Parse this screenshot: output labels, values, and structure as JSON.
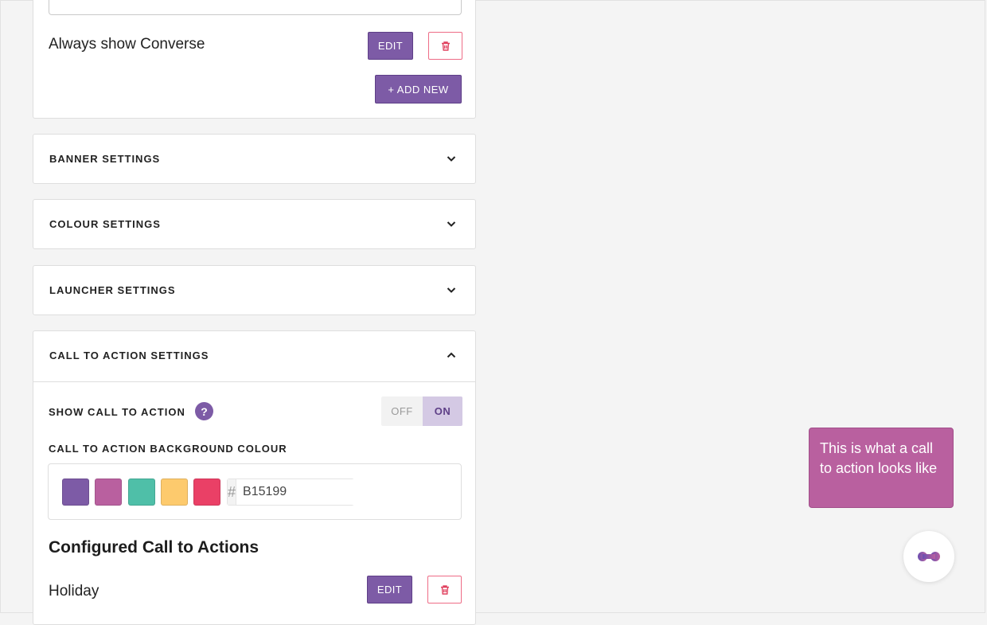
{
  "rules": {
    "items": [
      {
        "label": "Always show Converse",
        "edit_label": "EDIT"
      }
    ],
    "add_new_label": "+ ADD NEW"
  },
  "sections": {
    "banner": "BANNER SETTINGS",
    "colour": "COLOUR SETTINGS",
    "launcher": "LAUNCHER SETTINGS"
  },
  "cta": {
    "title": "CALL TO ACTION SETTINGS",
    "show_label": "SHOW CALL TO ACTION",
    "help_glyph": "?",
    "toggle": {
      "off": "OFF",
      "on": "ON",
      "state": "ON"
    },
    "bg_colour_label": "CALL TO ACTION BACKGROUND COLOUR",
    "swatches": [
      "#7d5ba6",
      "#b9609f",
      "#4fbfa8",
      "#fdca6d",
      "#ea4066"
    ],
    "hex_prefix": "#",
    "hex_value": "B15199",
    "configured_title": "Configured Call to Actions",
    "configured_items": [
      {
        "label": "Holiday",
        "edit_label": "EDIT"
      }
    ]
  },
  "preview": {
    "tooltip_text": "This is what a call to action looks like"
  },
  "colors": {
    "accent": "#7d5ba6",
    "danger": "#ee6c86",
    "tooltip_bg": "#b9609f"
  },
  "icons": {
    "delete": "trash-icon",
    "expand": "chevron-down-icon",
    "collapse": "chevron-up-icon",
    "help": "question-icon",
    "launcher": "chat-launcher-icon"
  }
}
